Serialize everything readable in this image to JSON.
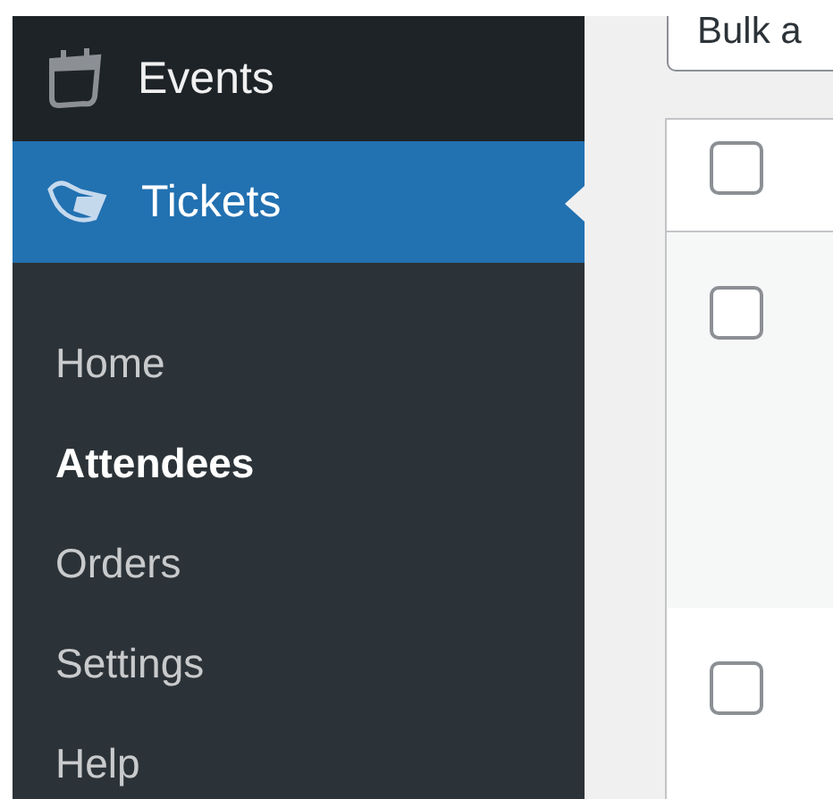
{
  "sidebar": {
    "menu": [
      {
        "label": "Events",
        "selected": false
      },
      {
        "label": "Tickets",
        "selected": true
      }
    ],
    "submenu": [
      {
        "label": "Home",
        "selected": false
      },
      {
        "label": "Attendees",
        "selected": true
      },
      {
        "label": "Orders",
        "selected": false
      },
      {
        "label": "Settings",
        "selected": false
      },
      {
        "label": "Help",
        "selected": false
      }
    ]
  },
  "bulk_actions": {
    "value": "Bulk a"
  },
  "table": {
    "header": {
      "checked": false
    },
    "rows": [
      {
        "checked": false
      },
      {
        "checked": false
      }
    ]
  }
}
